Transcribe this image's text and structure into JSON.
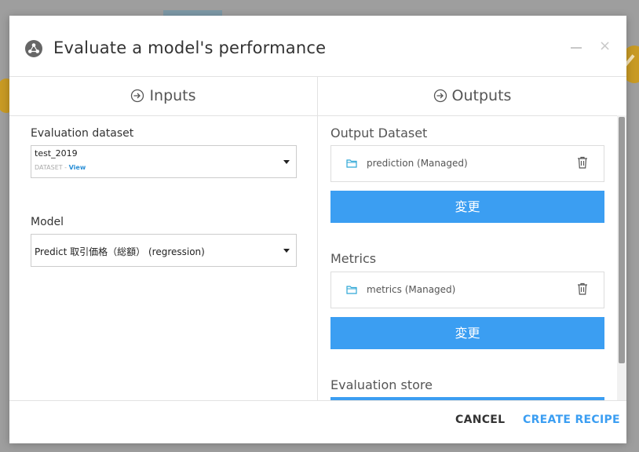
{
  "dialog": {
    "title": "Evaluate a model's performance",
    "minimize_glyph": "−",
    "close_glyph": "×"
  },
  "inputs": {
    "header": "Inputs",
    "evaluation_dataset": {
      "label": "Evaluation dataset",
      "value": "test_2019",
      "type_label": "DATASET",
      "separator": " - ",
      "view_link": "View"
    },
    "model": {
      "label": "Model",
      "value": "Predict 取引価格（総額） (regression)"
    }
  },
  "outputs": {
    "header": "Outputs",
    "output_dataset": {
      "label": "Output Dataset",
      "item": "prediction (Managed)",
      "change_button": "変更"
    },
    "metrics": {
      "label": "Metrics",
      "item": "metrics (Managed)",
      "change_button": "変更"
    },
    "evaluation_store": {
      "label": "Evaluation store"
    }
  },
  "footer": {
    "cancel": "CANCEL",
    "create": "CREATE RECIPE"
  },
  "colors": {
    "accent": "#3b9ef2",
    "folder_icon": "#2fa7d6"
  },
  "icons": [
    "recipe-icon",
    "enter-icon",
    "folder-icon",
    "trash-icon"
  ]
}
